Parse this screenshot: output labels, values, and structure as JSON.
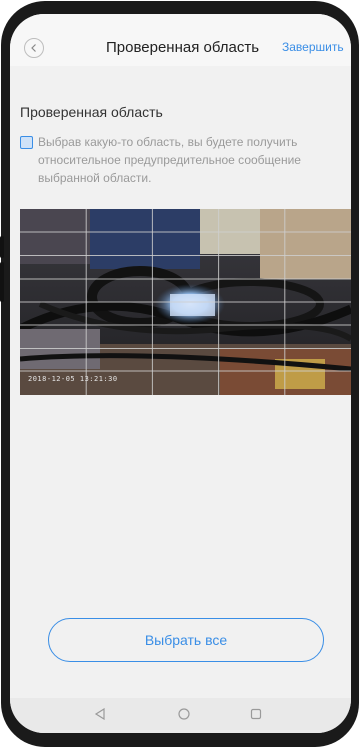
{
  "header": {
    "title": "Проверенная область",
    "finish_label": "Завершить"
  },
  "section": {
    "title": "Проверенная область",
    "checkbox_checked": false,
    "hint": "Выбрав какую-то область, вы будете получить относительное предупредительное сообщение выбранной области."
  },
  "camera": {
    "timestamp": "2018-12-05 13:21:30",
    "grid": {
      "columns": 5,
      "rows": 4
    }
  },
  "actions": {
    "select_all_label": "Выбрать все"
  },
  "icons": {
    "back": "chevron-left-icon",
    "nav_back": "triangle-back-icon",
    "nav_home": "circle-home-icon",
    "nav_recents": "square-recents-icon"
  },
  "colors": {
    "accent": "#3a8ee6",
    "background": "#f1f1f1",
    "hint_text": "#9a9a9a"
  }
}
